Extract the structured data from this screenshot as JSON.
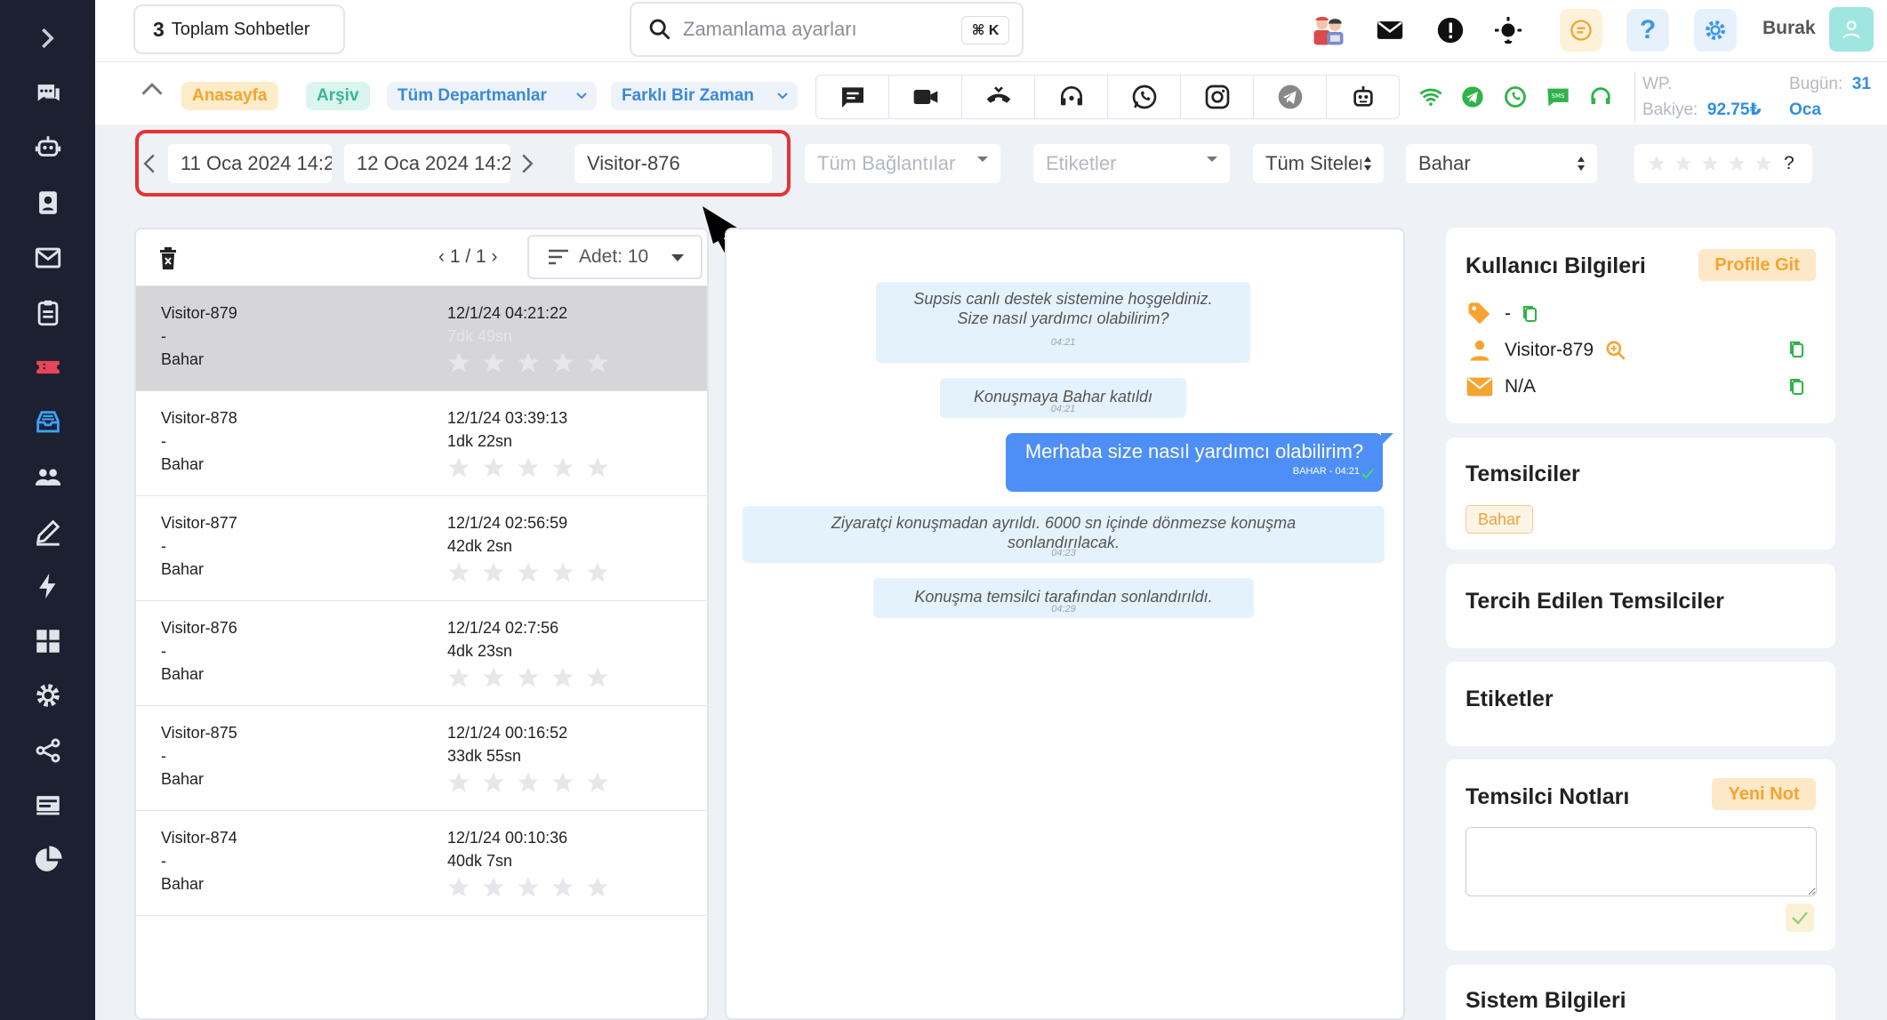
{
  "sidebar": {
    "items": [
      {
        "icon": "expand-chevron-icon"
      },
      {
        "icon": "chat-bubbles-icon"
      },
      {
        "icon": "robot-icon"
      },
      {
        "icon": "contact-card-icon"
      },
      {
        "icon": "mail-icon"
      },
      {
        "icon": "clipboard-icon"
      },
      {
        "icon": "ticket-icon",
        "color": "#e8455a"
      },
      {
        "icon": "archive-inbox-icon",
        "color": "#3aa3ff"
      },
      {
        "icon": "users-icon"
      },
      {
        "icon": "edit-pen-icon"
      },
      {
        "icon": "lightning-icon"
      },
      {
        "icon": "grid-icon"
      },
      {
        "icon": "settings-gear-icon"
      },
      {
        "icon": "share-icon"
      },
      {
        "icon": "dashboard-icon"
      },
      {
        "icon": "pie-chart-icon"
      }
    ]
  },
  "topbar": {
    "chat_count": "3",
    "chat_count_label": "Toplam Sohbetler",
    "search_placeholder": "Zamanlama ayarları",
    "search_shortcut": "⌘ K",
    "user_name": "Burak"
  },
  "navbar": {
    "home": "Anasayfa",
    "archive": "Arşiv",
    "departments": "Tüm Departmanlar",
    "time": "Farklı Bir Zaman",
    "wp_label": "WP.",
    "balance_label": "Bakiye:",
    "balance_value": "92.75₺",
    "today_label": "Bugün:",
    "today_value": "31",
    "today_month": "Oca"
  },
  "filters": {
    "date_start": "11 Oca 2024 14:2",
    "date_end": "12 Oca 2024 14:2",
    "visitor": "Visitor-876",
    "connections": "Tüm Bağlantılar",
    "tags": "Etiketler",
    "sites": "Tüm Siteler",
    "agent": "Bahar",
    "rating_help": "?"
  },
  "list": {
    "pager": "‹ 1 / 1 ›",
    "count_label": "Adet: 10",
    "rows": [
      {
        "visitor": "Visitor-879",
        "dash": "-",
        "agent": "Bahar",
        "date": "12/1/24 04:21:22",
        "duration": "7dk 49sn",
        "active": true
      },
      {
        "visitor": "Visitor-878",
        "dash": "-",
        "agent": "Bahar",
        "date": "12/1/24 03:39:13",
        "duration": "1dk 22sn"
      },
      {
        "visitor": "Visitor-877",
        "dash": "-",
        "agent": "Bahar",
        "date": "12/1/24 02:56:59",
        "duration": "42dk 2sn"
      },
      {
        "visitor": "Visitor-876",
        "dash": "-",
        "agent": "Bahar",
        "date": "12/1/24 02:7:56",
        "duration": "4dk 23sn"
      },
      {
        "visitor": "Visitor-875",
        "dash": "-",
        "agent": "Bahar",
        "date": "12/1/24 00:16:52",
        "duration": "33dk 55sn"
      },
      {
        "visitor": "Visitor-874",
        "dash": "-",
        "agent": "Bahar",
        "date": "12/1/24 00:10:36",
        "duration": "40dk 7sn"
      }
    ]
  },
  "chat": {
    "welcome_1": "Supsis canlı destek sistemine hoşgeldiniz.",
    "welcome_2": "Size nasıl yardımcı olabilirim?",
    "welcome_time": "04:21",
    "joined": "Konuşmaya Bahar katıldı",
    "joined_time": "04:21",
    "agent_msg": "Merhaba size nasıl yardımcı olabilirim?",
    "agent_msg_meta": "BAHAR - 04:21",
    "left_1": "Ziyaratçi konuşmadan ayrıldı. 6000 sn içinde dönmezse konuşma",
    "left_2": "sonlandırılacak.",
    "left_time": "04:23",
    "ended": "Konuşma temsilci tarafından sonlandırıldı.",
    "ended_time": "04:29"
  },
  "panel": {
    "user_info_title": "Kullanıcı Bilgileri",
    "profile_button": "Profile Git",
    "tag_value": "-",
    "visitor_name": "Visitor-879",
    "email_value": "N/A",
    "reps_title": "Temsilciler",
    "rep_chip": "Bahar",
    "preferred_title": "Tercih Edilen Temsilciler",
    "tags_title": "Etiketler",
    "notes_title": "Temsilci Notları",
    "new_note_button": "Yeni Not",
    "system_title": "Sistem Bilgileri"
  },
  "colors": {
    "sidebar_bg": "#1c2030",
    "highlight_red": "#e53333",
    "agent_bubble": "#4d8ff7",
    "system_bubble": "#e4f2fb",
    "accent_orange": "#f5a430",
    "whatsapp_green": "#2fb34a"
  }
}
